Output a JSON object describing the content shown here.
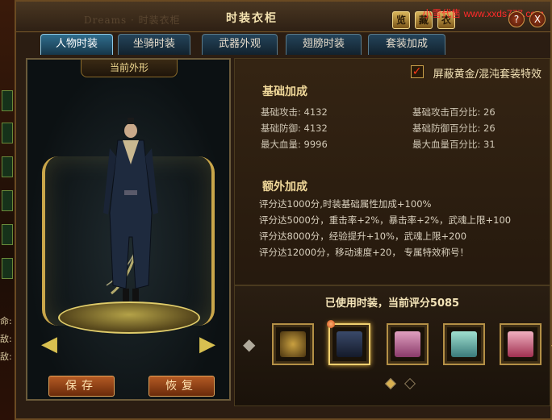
{
  "background_window": {
    "title": "Dreams · 时装衣柜"
  },
  "left_strip": {
    "labels": [
      "命:",
      "敌:",
      "敌:"
    ]
  },
  "window": {
    "title": "时装衣柜",
    "watermark": "小雪代售 www.xxds777.com",
    "title_buttons": [
      "览",
      "藏",
      "衣"
    ],
    "help_label": "?",
    "close_label": "X"
  },
  "tabs": [
    {
      "label": "人物时装",
      "active": true
    },
    {
      "label": "坐骑时装",
      "active": false
    },
    {
      "label": "武器外观",
      "active": false
    },
    {
      "label": "翅膀时装",
      "active": false
    },
    {
      "label": "套装加成",
      "active": false
    }
  ],
  "preview": {
    "title": "当前外形",
    "rotate_left_icon": "rotate-left-arrow",
    "rotate_right_icon": "rotate-right-arrow",
    "save_label": "保存",
    "restore_label": "恢复"
  },
  "info": {
    "checkbox_label": "屏蔽黄金/混沌套装特效",
    "checkbox_checked": true,
    "base_title": "基础加成",
    "base_stats_left": [
      {
        "label": "基础攻击",
        "value": "4132"
      },
      {
        "label": "基础防御",
        "value": "4132"
      },
      {
        "label": "最大血量",
        "value": "9996"
      }
    ],
    "base_stats_right": [
      {
        "label": "基础攻击百分比",
        "value": "26"
      },
      {
        "label": "基础防御百分比",
        "value": "26"
      },
      {
        "label": "最大血量百分比",
        "value": "31"
      }
    ],
    "extra_title": "额外加成",
    "extra_bonuses": [
      "评分达1000分,时装基础属性加成+100%",
      "评分达5000分，重击率+2%，暴击率+2%，武魂上限+100",
      "评分达8000分，经验提升+10%，武魂上限+200",
      "评分达12000分，移动速度+20， 专属特效称号！"
    ]
  },
  "outfits": {
    "title": "已使用时装，当前评分5085",
    "slots": [
      {
        "name": "outfit-helmet-gold",
        "selected": false
      },
      {
        "name": "outfit-dark-robe",
        "selected": true
      },
      {
        "name": "outfit-pink-robe",
        "selected": false
      },
      {
        "name": "outfit-teal-robe",
        "selected": false
      },
      {
        "name": "outfit-red-robe",
        "selected": false
      }
    ],
    "page_count": 2,
    "current_page": 1
  },
  "colors": {
    "gold_text": "#f0d89a",
    "tab_active": "#2f6d8d",
    "button_orange": "#b45a24"
  }
}
